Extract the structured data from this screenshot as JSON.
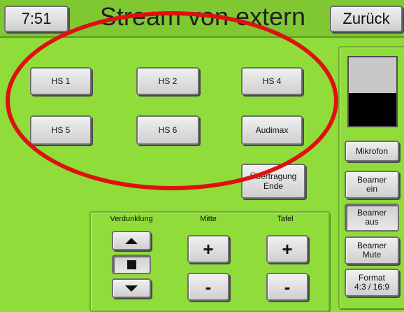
{
  "header": {
    "time": "7:51",
    "title": "Stream von extern",
    "back_label": "Zurück"
  },
  "rooms": {
    "hs1": "HS 1",
    "hs2": "HS 2",
    "hs4": "HS 4",
    "hs5": "HS 5",
    "hs6": "HS 6",
    "audimax": "Audimax"
  },
  "end_transmission": {
    "line1": "Übertragung",
    "line2": "Ende"
  },
  "controls": {
    "verdunklung_label": "Verdunklung",
    "mitte_label": "Mitte",
    "tafel_label": "Tafel",
    "plus": "+",
    "minus": "-"
  },
  "side": {
    "level_fraction": 0.48,
    "mikrofon": "Mikrofon",
    "beamer_ein_1": "Beamer",
    "beamer_ein_2": "ein",
    "beamer_aus_1": "Beamer",
    "beamer_aus_2": "aus",
    "beamer_mute_1": "Beamer",
    "beamer_mute_2": "Mute",
    "format_1": "Format",
    "format_2": "4:3 / 16:9"
  },
  "colors": {
    "background": "#8fdc3a",
    "highlight_oval": "#e01010"
  }
}
